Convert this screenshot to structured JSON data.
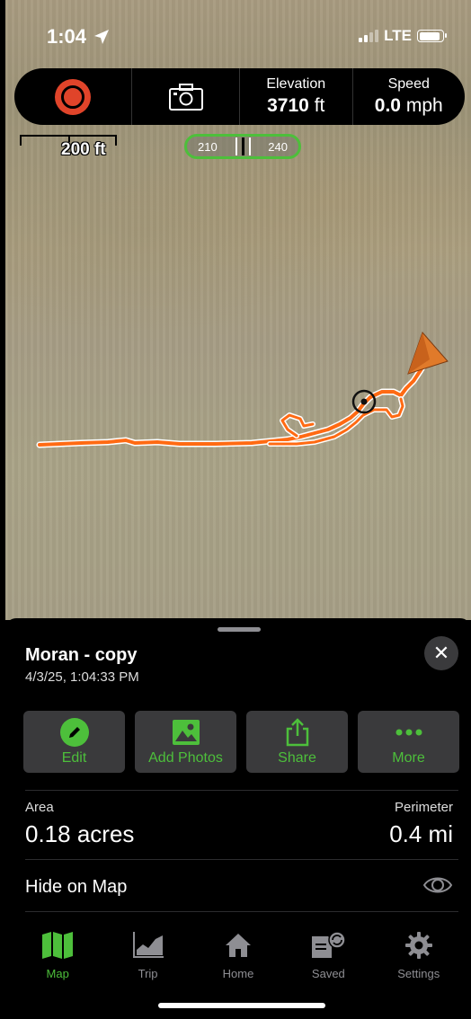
{
  "status_bar": {
    "time": "1:04",
    "network": "LTE"
  },
  "toolbar": {
    "record_icon": "record-icon",
    "camera_icon": "camera-icon",
    "elevation_label": "Elevation",
    "elevation_value": "3710",
    "elevation_unit": "ft",
    "speed_label": "Speed",
    "speed_value": "0.0",
    "speed_unit": "mph"
  },
  "map": {
    "scale_label": "200 ft",
    "compass_left": "210",
    "compass_right": "240",
    "track_color": "#ff6a13"
  },
  "sheet": {
    "title": "Moran - copy",
    "timestamp": "4/3/25, 1:04:33 PM",
    "actions": [
      {
        "label": "Edit",
        "icon": "pencil-icon"
      },
      {
        "label": "Add Photos",
        "icon": "photo-icon"
      },
      {
        "label": "Share",
        "icon": "share-icon"
      },
      {
        "label": "More",
        "icon": "more-icon"
      }
    ],
    "area_label": "Area",
    "area_value": "0.18 acres",
    "perimeter_label": "Perimeter",
    "perimeter_value": "0.4 mi",
    "hide_label": "Hide on Map"
  },
  "tabbar": {
    "tabs": [
      {
        "label": "Map",
        "icon": "map-icon",
        "active": true
      },
      {
        "label": "Trip",
        "icon": "chart-icon",
        "active": false
      },
      {
        "label": "Home",
        "icon": "home-icon",
        "active": false
      },
      {
        "label": "Saved",
        "icon": "saved-icon",
        "active": false
      },
      {
        "label": "Settings",
        "icon": "gear-icon",
        "active": false
      }
    ]
  },
  "colors": {
    "accent": "#4dbf3b",
    "record": "#e0442a",
    "sheet_bg": "#000000",
    "button_bg": "#3a3a3c"
  }
}
